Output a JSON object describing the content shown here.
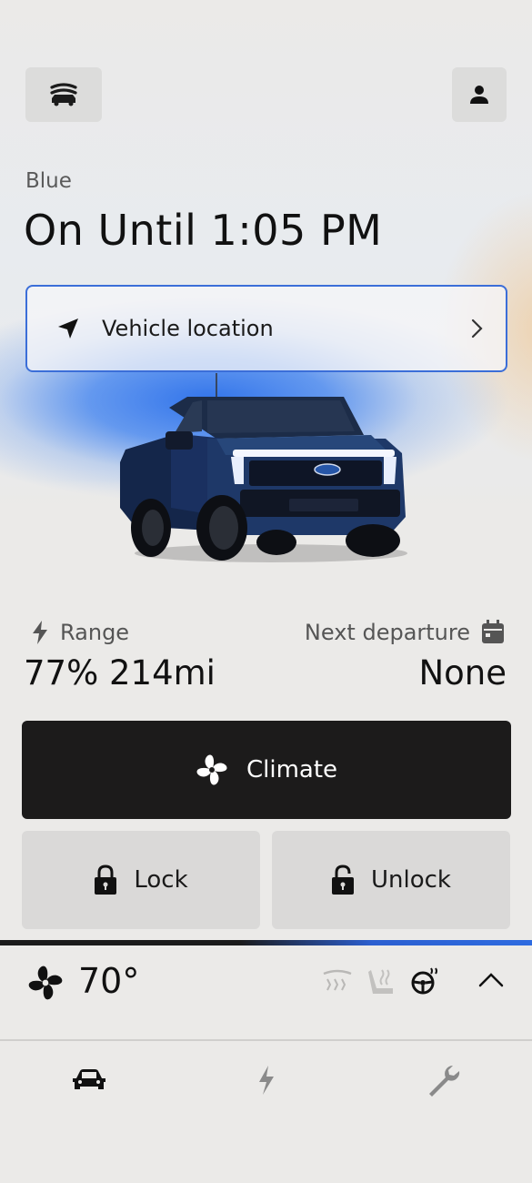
{
  "vehicle": {
    "name": "Blue",
    "status": "On Until 1:05 PM"
  },
  "location_card": {
    "label": "Vehicle location",
    "icon": "navigation-arrow-icon"
  },
  "stats": {
    "range_label": "Range",
    "range_value": "77% 214mi",
    "departure_label": "Next departure",
    "departure_value": "None"
  },
  "actions": {
    "climate_label": "Climate",
    "lock_label": "Lock",
    "unlock_label": "Unlock"
  },
  "climate_bar": {
    "temperature": "70°",
    "icons": [
      "defrost-icon",
      "heated-seat-icon",
      "heated-steering-wheel-icon"
    ]
  },
  "bottom_nav": {
    "items": [
      "car-icon",
      "charging-bolt-icon",
      "wrench-icon"
    ],
    "active": "car-icon"
  },
  "colors": {
    "accent_blue": "#3b6ed8",
    "dark_button": "#1c1b1b",
    "background": "#ebeae8"
  }
}
